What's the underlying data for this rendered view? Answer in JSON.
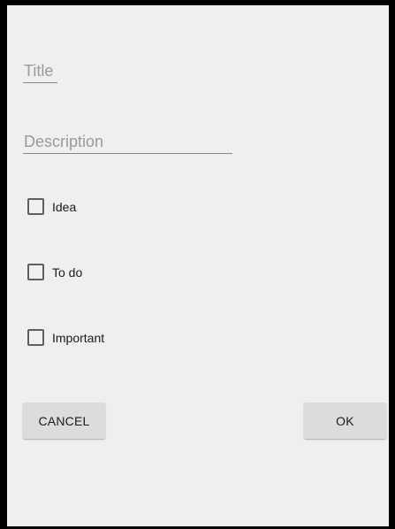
{
  "form": {
    "title_placeholder": "Title",
    "title_value": "",
    "description_placeholder": "Description",
    "description_value": ""
  },
  "checkboxes": [
    {
      "label": "Idea",
      "checked": false
    },
    {
      "label": "To do",
      "checked": false
    },
    {
      "label": "Important",
      "checked": false
    }
  ],
  "buttons": {
    "cancel_label": "CANCEL",
    "ok_label": "OK"
  },
  "colors": {
    "dialog_background": "#efefef",
    "button_background": "#dcdcdc",
    "underline": "#8a8a8a",
    "placeholder_text": "#9a9a9a"
  }
}
